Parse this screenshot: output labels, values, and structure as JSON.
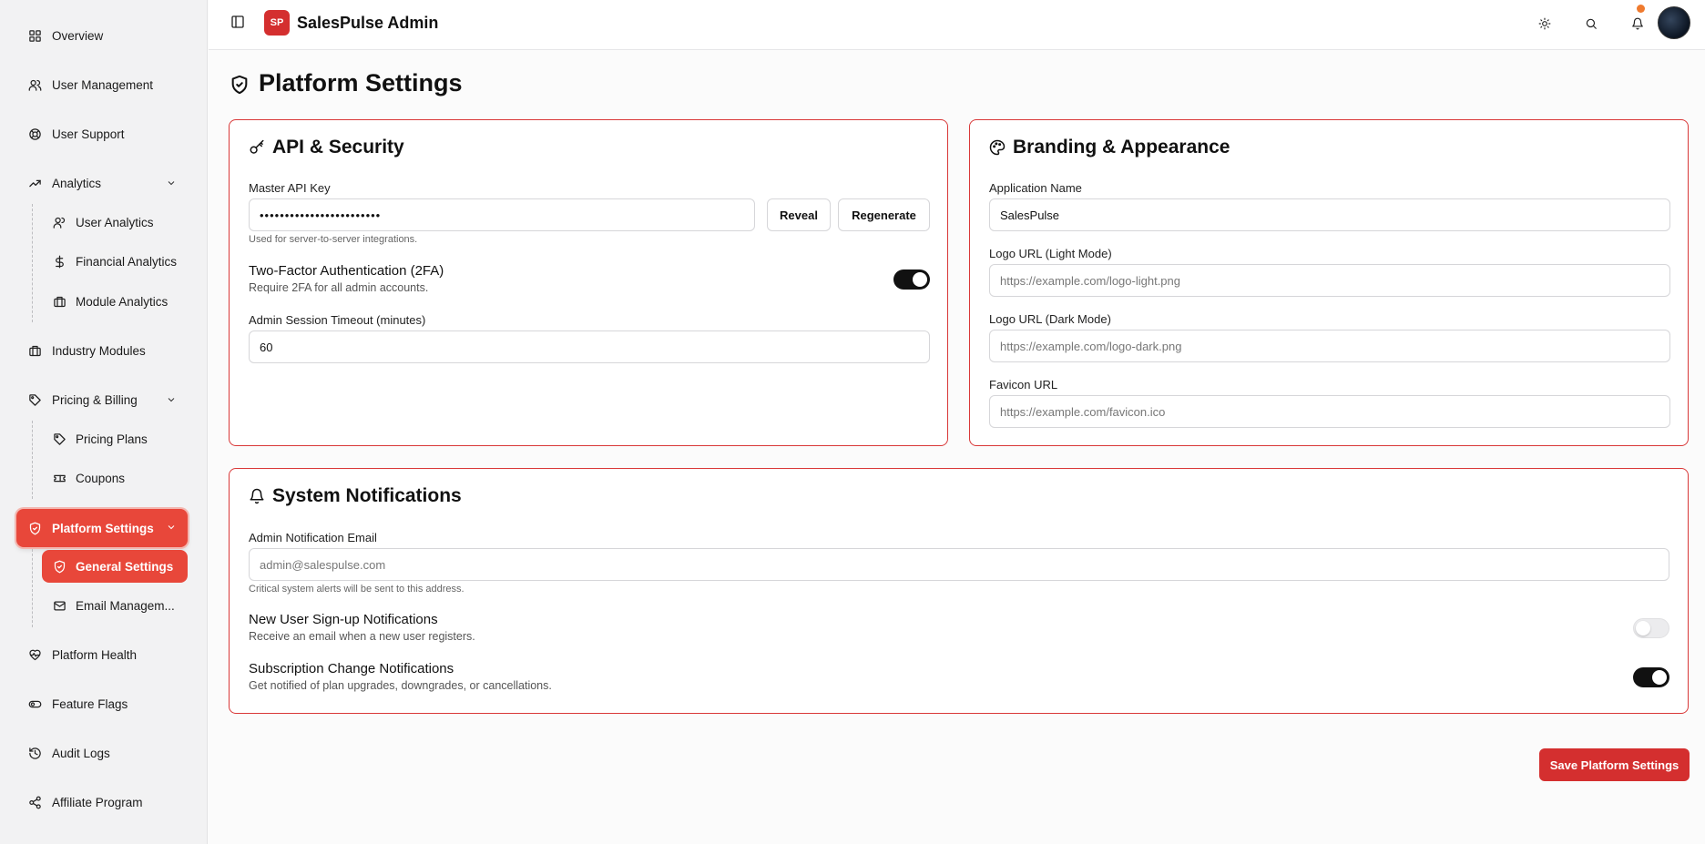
{
  "header": {
    "logo_text": "SP",
    "app_title": "SalesPulse Admin"
  },
  "sidebar": {
    "overview": "Overview",
    "user_management": "User Management",
    "user_support": "User Support",
    "analytics": "Analytics",
    "user_analytics": "User Analytics",
    "financial_analytics": "Financial Analytics",
    "module_analytics": "Module Analytics",
    "industry_modules": "Industry Modules",
    "pricing_billing": "Pricing & Billing",
    "pricing_plans": "Pricing Plans",
    "coupons": "Coupons",
    "platform_settings": "Platform Settings",
    "general_settings": "General Settings",
    "email_management": "Email Managem...",
    "platform_health": "Platform Health",
    "feature_flags": "Feature Flags",
    "audit_logs": "Audit Logs",
    "affiliate_program": "Affiliate Program"
  },
  "page": {
    "title": "Platform Settings"
  },
  "api_security": {
    "title": "API & Security",
    "api_key_label": "Master API Key",
    "api_key_value": "••••••••••••••••••••••••",
    "reveal_label": "Reveal",
    "regenerate_label": "Regenerate",
    "api_key_hint": "Used for server-to-server integrations.",
    "twofa_title": "Two-Factor Authentication (2FA)",
    "twofa_desc": "Require 2FA for all admin accounts.",
    "twofa_enabled": true,
    "timeout_label": "Admin Session Timeout (minutes)",
    "timeout_value": "60"
  },
  "branding": {
    "title": "Branding & Appearance",
    "app_name_label": "Application Name",
    "app_name_value": "SalesPulse",
    "logo_light_label": "Logo URL (Light Mode)",
    "logo_light_placeholder": "https://example.com/logo-light.png",
    "logo_dark_label": "Logo URL (Dark Mode)",
    "logo_dark_placeholder": "https://example.com/logo-dark.png",
    "favicon_label": "Favicon URL",
    "favicon_placeholder": "https://example.com/favicon.ico"
  },
  "notifications": {
    "title": "System Notifications",
    "email_label": "Admin Notification Email",
    "email_placeholder": "admin@salespulse.com",
    "email_hint": "Critical system alerts will be sent to this address.",
    "signup_title": "New User Sign-up Notifications",
    "signup_desc": "Receive an email when a new user registers.",
    "signup_enabled": false,
    "subscription_title": "Subscription Change Notifications",
    "subscription_desc": "Get notified of plan upgrades, downgrades, or cancellations.",
    "subscription_enabled": true
  },
  "actions": {
    "save_label": "Save Platform Settings"
  },
  "colors": {
    "accent": "#e8473a",
    "brand": "#d42f2f",
    "card_border": "#d93838",
    "notification_dot": "#ef7a2e"
  }
}
